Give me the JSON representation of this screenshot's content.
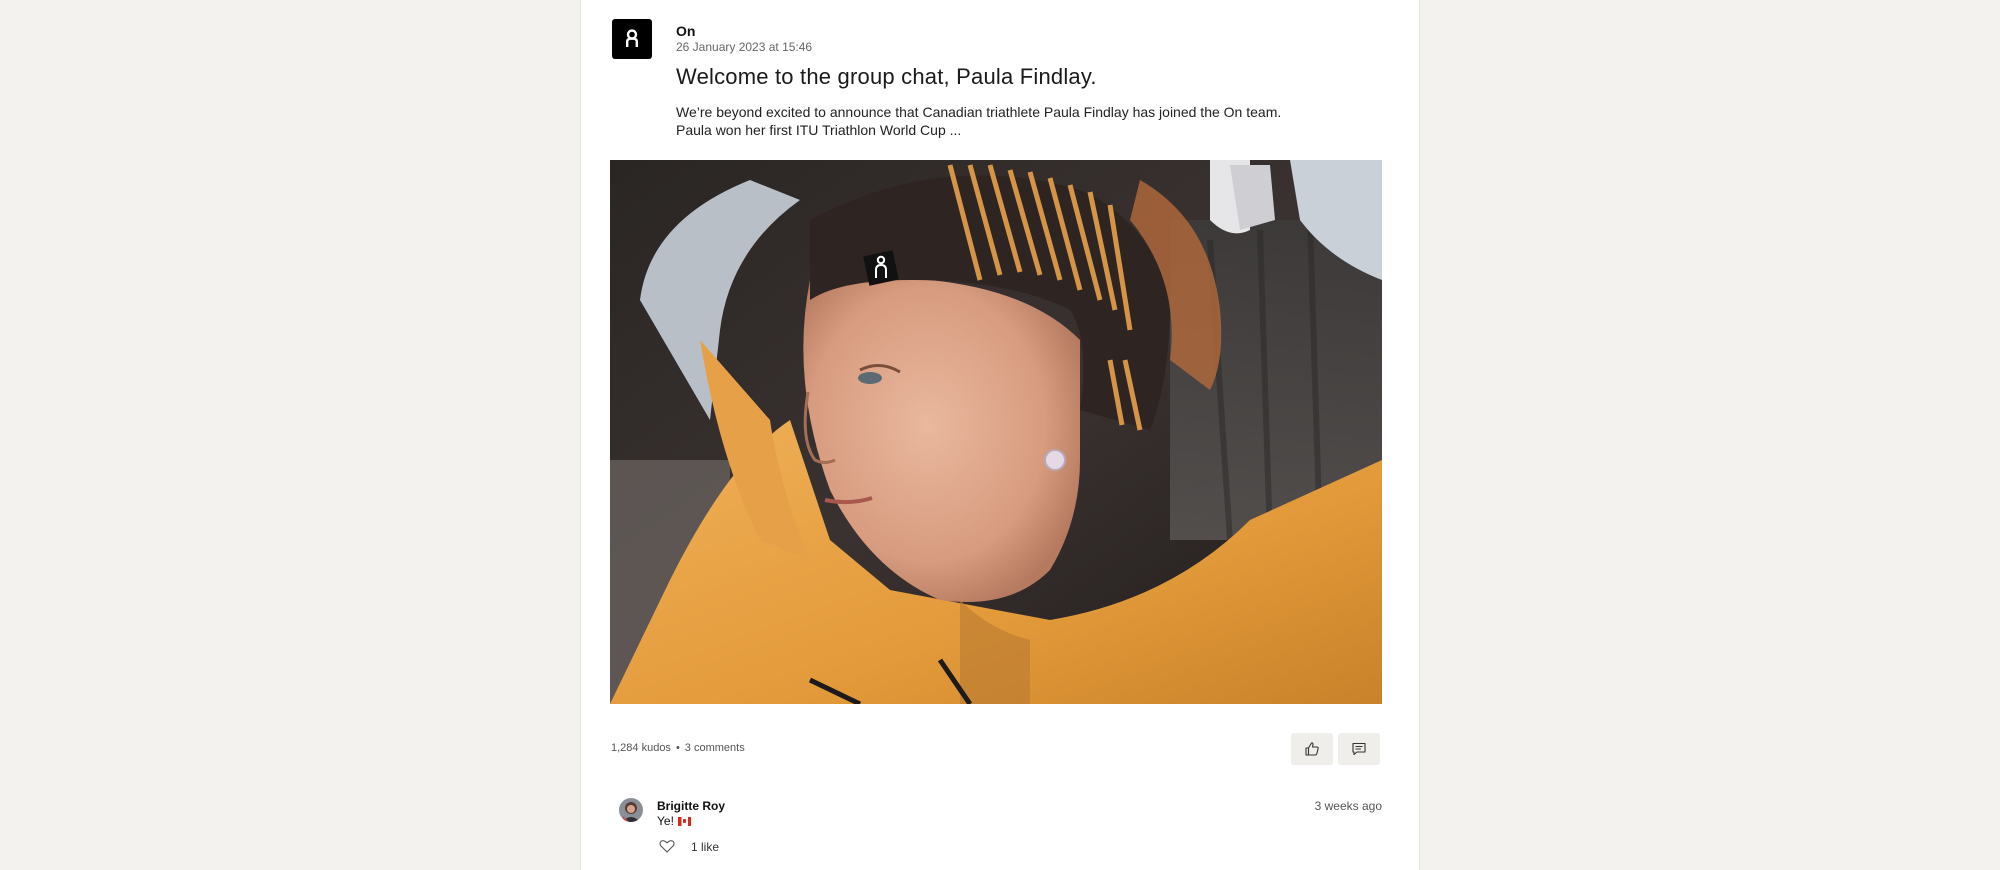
{
  "post": {
    "author": "On",
    "date": "26 January 2023 at 15:46",
    "title": "Welcome to the group chat, Paula Findlay.",
    "excerpt_line1": "We’re beyond excited to announce that Canadian triathlete Paula Findlay has joined the On team.",
    "excerpt_line2": "Paula won her first ITU Triathlon World Cup ..."
  },
  "stats": {
    "kudos": "1,284 kudos",
    "separator": "•",
    "comments": "3 comments"
  },
  "actions": {
    "kudos_icon": "thumbs-up-icon",
    "comment_icon": "comment-icon"
  },
  "comment": {
    "author": "Brigitte Roy",
    "text": "Ye!",
    "emoji": "canada-flag",
    "time": "3 weeks ago",
    "likes": "1 like"
  },
  "colors": {
    "background": "#f3f2ee",
    "card": "#ffffff",
    "brand": "#000000",
    "button_bg": "#efeeea",
    "jacket": "#e8a040"
  }
}
